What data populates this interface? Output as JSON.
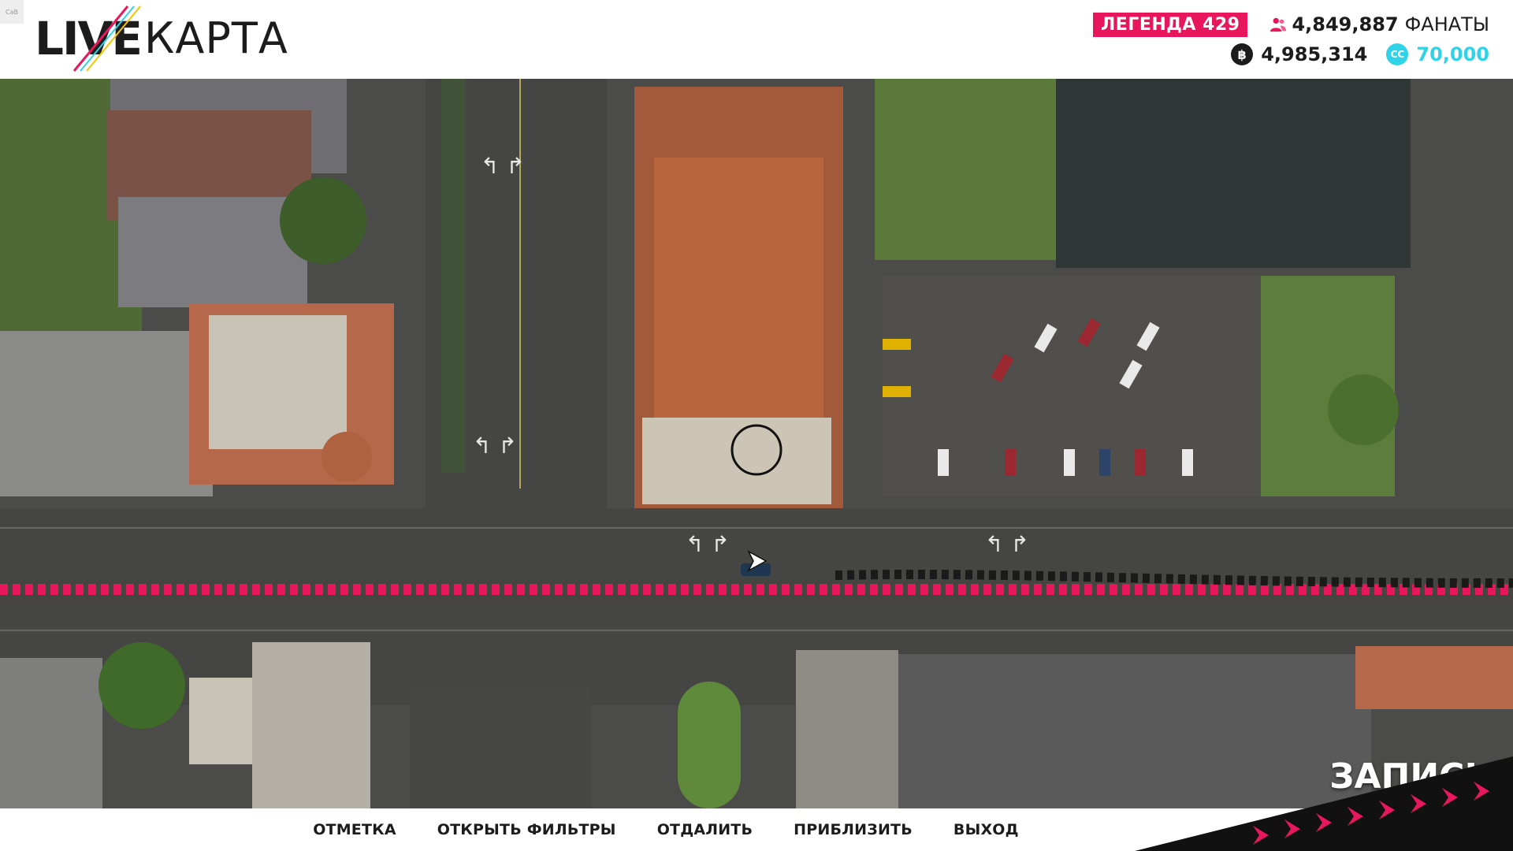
{
  "corner_tag": "CaB",
  "logo": {
    "live": "LIVE",
    "map": "КАРТА"
  },
  "stats": {
    "legend_badge": "ЛЕГЕНДА 429",
    "fans_value": "4,849,887",
    "fans_label": "ФАНАТЫ",
    "credits_value": "4,985,314",
    "cc_icon_text": "CC",
    "cc_value": "70,000"
  },
  "map": {
    "record_label": "ЗАПИСЬ"
  },
  "actions": [
    {
      "label": "ОТМЕТКА"
    },
    {
      "label": "ОТКРЫТЬ ФИЛЬТРЫ"
    },
    {
      "label": "ОТДАЛИТЬ"
    },
    {
      "label": "ПРИБЛИЗИТЬ"
    },
    {
      "label": "ВЫХОД"
    }
  ],
  "colors": {
    "accent_pink": "#e8175d",
    "accent_cyan": "#2fd3e8",
    "text_dark": "#1c1c1c"
  },
  "icons": {
    "fans": "people-icon",
    "credits": "coin-icon",
    "cc": "cc-coin-icon",
    "player": "player-arrow-icon",
    "cursor": "map-cursor-icon"
  }
}
